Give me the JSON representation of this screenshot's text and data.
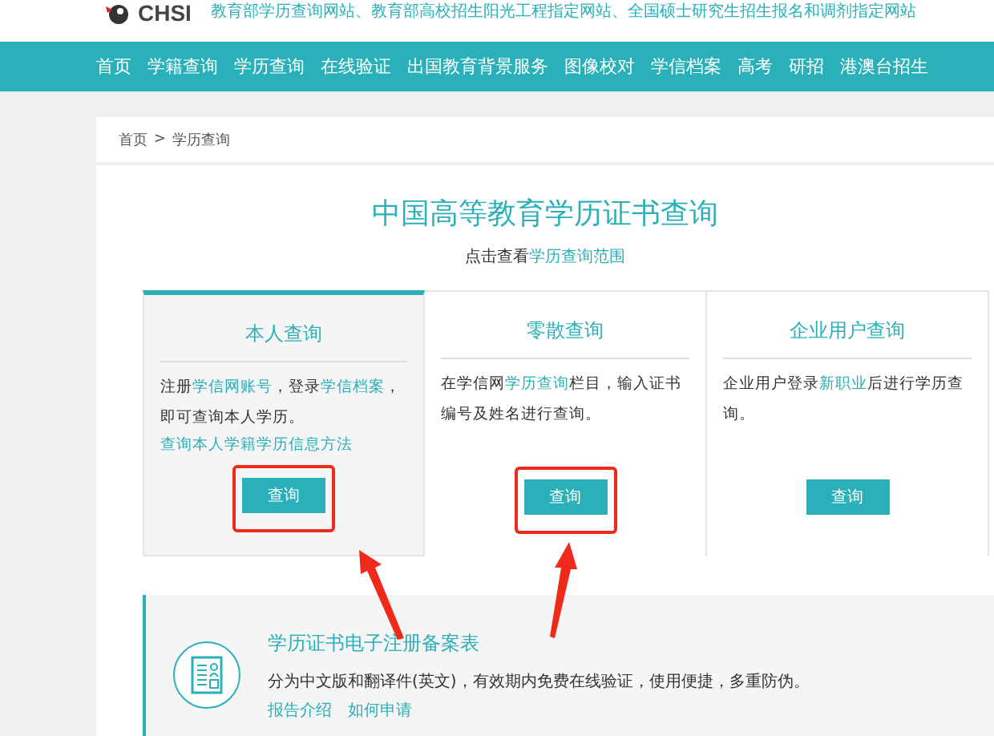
{
  "header": {
    "logo": "CHSI",
    "tagline": "教育部学历查询网站、教育部高校招生阳光工程指定网站、全国硕士研究生招生报名和调剂指定网站"
  },
  "nav": [
    "首页",
    "学籍查询",
    "学历查询",
    "在线验证",
    "出国教育背景服务",
    "图像校对",
    "学信档案",
    "高考",
    "研招",
    "港澳台招生"
  ],
  "breadcrumb": [
    "首页",
    ">",
    "学历查询"
  ],
  "title": "中国高等教育学历证书查询",
  "subtitle": [
    {
      "text": "点击查看",
      "link": false
    },
    {
      "text": "学历查询范围",
      "link": true
    }
  ],
  "cards": [
    {
      "title": "本人查询",
      "selected": true,
      "highlighted": true,
      "description": [
        {
          "text": "注册",
          "link": false
        },
        {
          "text": "学信网账号",
          "link": true
        },
        {
          "text": "，登录",
          "link": false
        },
        {
          "text": "学信档案",
          "link": true
        },
        {
          "text": "，即可查询本人学历。",
          "link": false
        }
      ],
      "extra_link": "查询本人学籍学历信息方法",
      "button": "查询"
    },
    {
      "title": "零散查询",
      "selected": false,
      "highlighted": true,
      "description": [
        {
          "text": "在学信网",
          "link": false
        },
        {
          "text": "学历查询",
          "link": true
        },
        {
          "text": "栏目，输入证书编号及姓名进行查询。",
          "link": false
        }
      ],
      "button": "查询"
    },
    {
      "title": "企业用户查询",
      "selected": false,
      "highlighted": false,
      "description": [
        {
          "text": "企业用户登录",
          "link": false
        },
        {
          "text": "新职业",
          "link": true
        },
        {
          "text": "后进行学历查询。",
          "link": false
        }
      ],
      "button": "查询"
    }
  ],
  "banner": {
    "title": "学历证书电子注册备案表",
    "text": "分为中文版和翻译件(英文)，有效期内免费在线验证，使用便捷，多重防伪。",
    "links": [
      "报告介绍",
      "如何申请"
    ]
  }
}
